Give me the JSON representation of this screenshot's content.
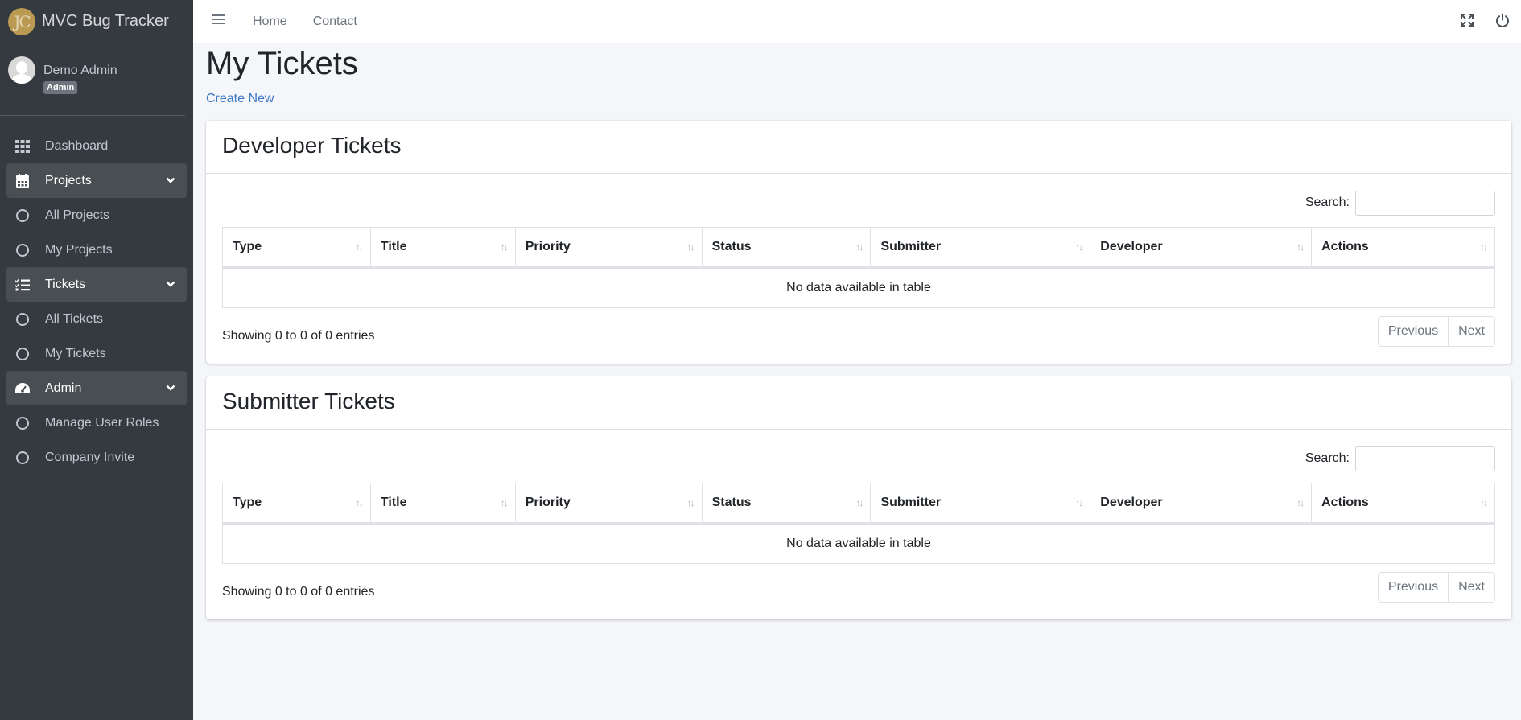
{
  "brand": {
    "logo_text": "JC",
    "name": "MVC Bug Tracker"
  },
  "user": {
    "name": "Demo Admin",
    "role": "Admin"
  },
  "sidebar": {
    "items": [
      {
        "label": "Dashboard",
        "icon": "grid-icon"
      },
      {
        "label": "Projects",
        "icon": "calendar-icon"
      },
      {
        "label": "All Projects",
        "icon": "circle-icon"
      },
      {
        "label": "My Projects",
        "icon": "circle-icon"
      },
      {
        "label": "Tickets",
        "icon": "tasks-icon"
      },
      {
        "label": "All Tickets",
        "icon": "circle-icon"
      },
      {
        "label": "My Tickets",
        "icon": "circle-icon"
      },
      {
        "label": "Admin",
        "icon": "gauge-icon"
      },
      {
        "label": "Manage User Roles",
        "icon": "circle-icon"
      },
      {
        "label": "Company Invite",
        "icon": "circle-icon"
      }
    ]
  },
  "topbar": {
    "home": "Home",
    "contact": "Contact"
  },
  "page": {
    "title": "My Tickets",
    "create_new": "Create New"
  },
  "developer_table": {
    "title": "Developer Tickets",
    "search_label": "Search:",
    "columns": [
      "Type",
      "Title",
      "Priority",
      "Status",
      "Submitter",
      "Developer",
      "Actions"
    ],
    "empty_text": "No data available in table",
    "info": "Showing 0 to 0 of 0 entries",
    "previous": "Previous",
    "next": "Next"
  },
  "submitter_table": {
    "title": "Submitter Tickets",
    "search_label": "Search:",
    "columns": [
      "Type",
      "Title",
      "Priority",
      "Status",
      "Submitter",
      "Developer",
      "Actions"
    ],
    "empty_text": "No data available in table",
    "info": "Showing 0 to 0 of 0 entries",
    "previous": "Previous",
    "next": "Next"
  },
  "colors": {
    "sidebar_bg": "#343a40",
    "link": "#3b76c4",
    "page_bg": "#f4f6f9"
  }
}
